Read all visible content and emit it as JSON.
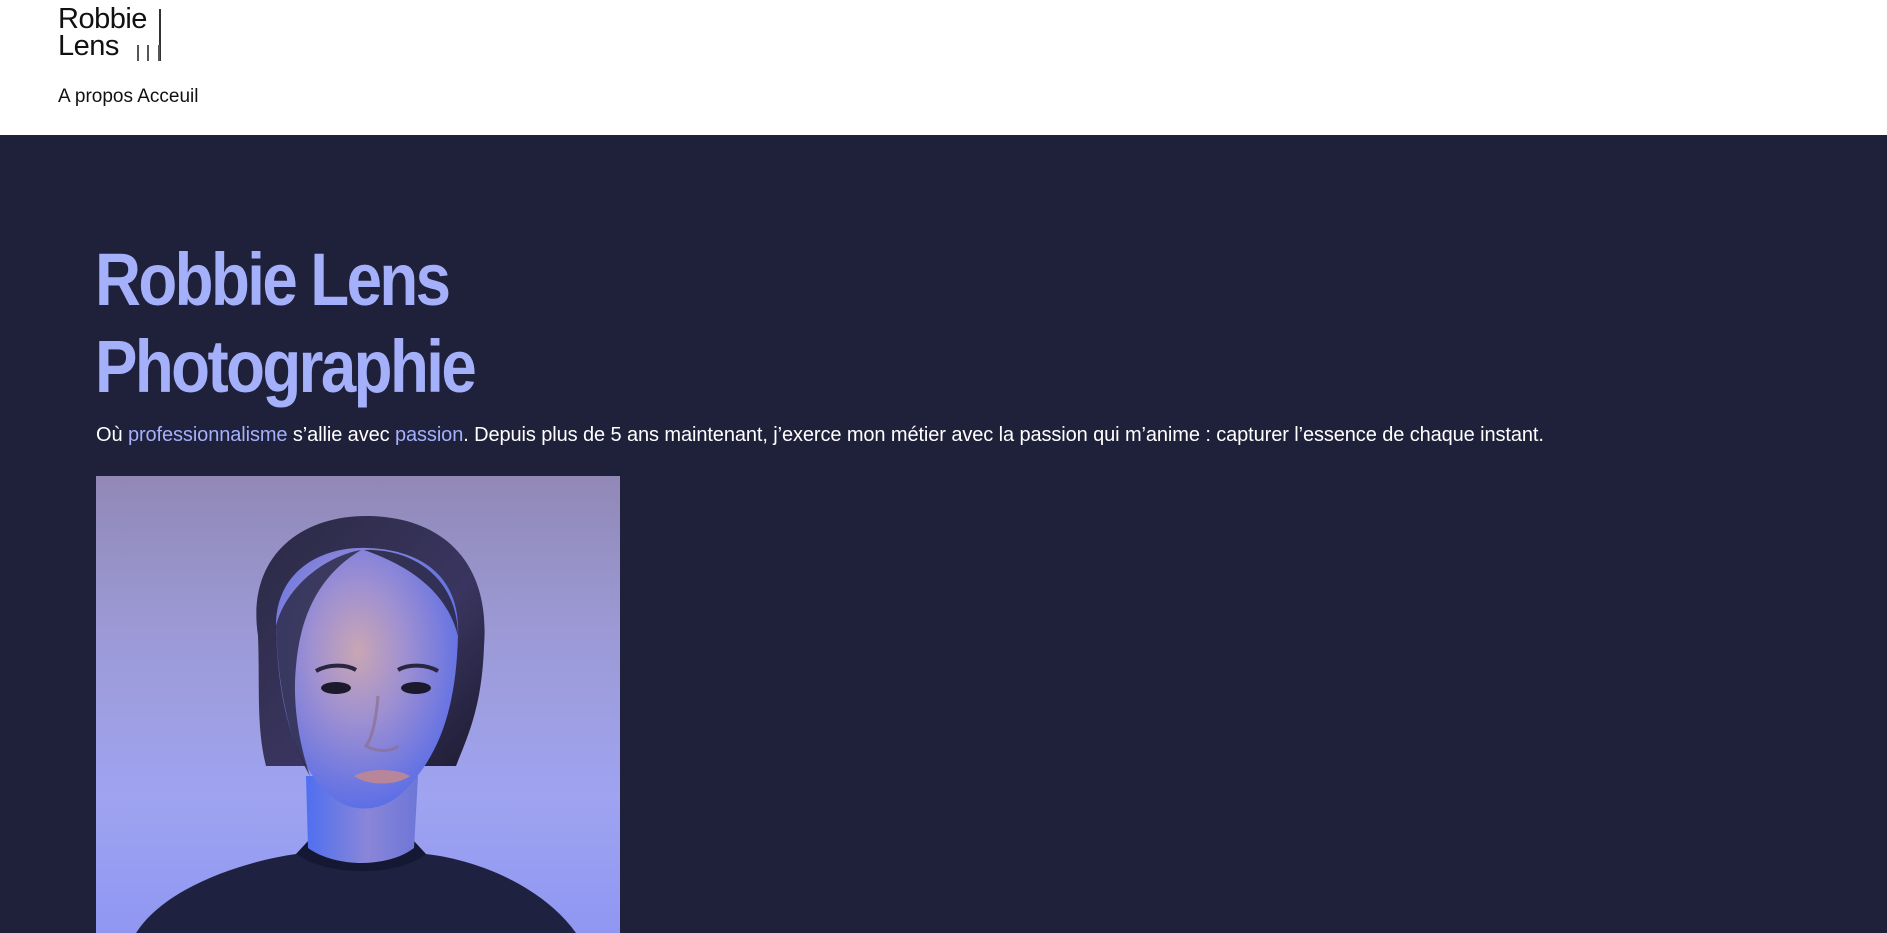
{
  "header": {
    "logo": {
      "line1": "Robbie",
      "line2": "Lens"
    },
    "nav": [
      {
        "label": "A propos"
      },
      {
        "label": "Acceuil"
      }
    ]
  },
  "hero": {
    "title_line1": "Robbie Lens",
    "title_line2": "Photographie",
    "intro": {
      "part1": "Où ",
      "highlight1": "professionnalisme",
      "part2": " s’allie avec ",
      "highlight2": "passion",
      "part3": ". Depuis plus de 5 ans maintenant, j’exerce mon métier avec la passion qui m’anime : capturer l’essence de chaque instant."
    }
  },
  "colors": {
    "accent": "#a5b0fb",
    "background": "#1f203a",
    "header_bg": "#ffffff"
  }
}
